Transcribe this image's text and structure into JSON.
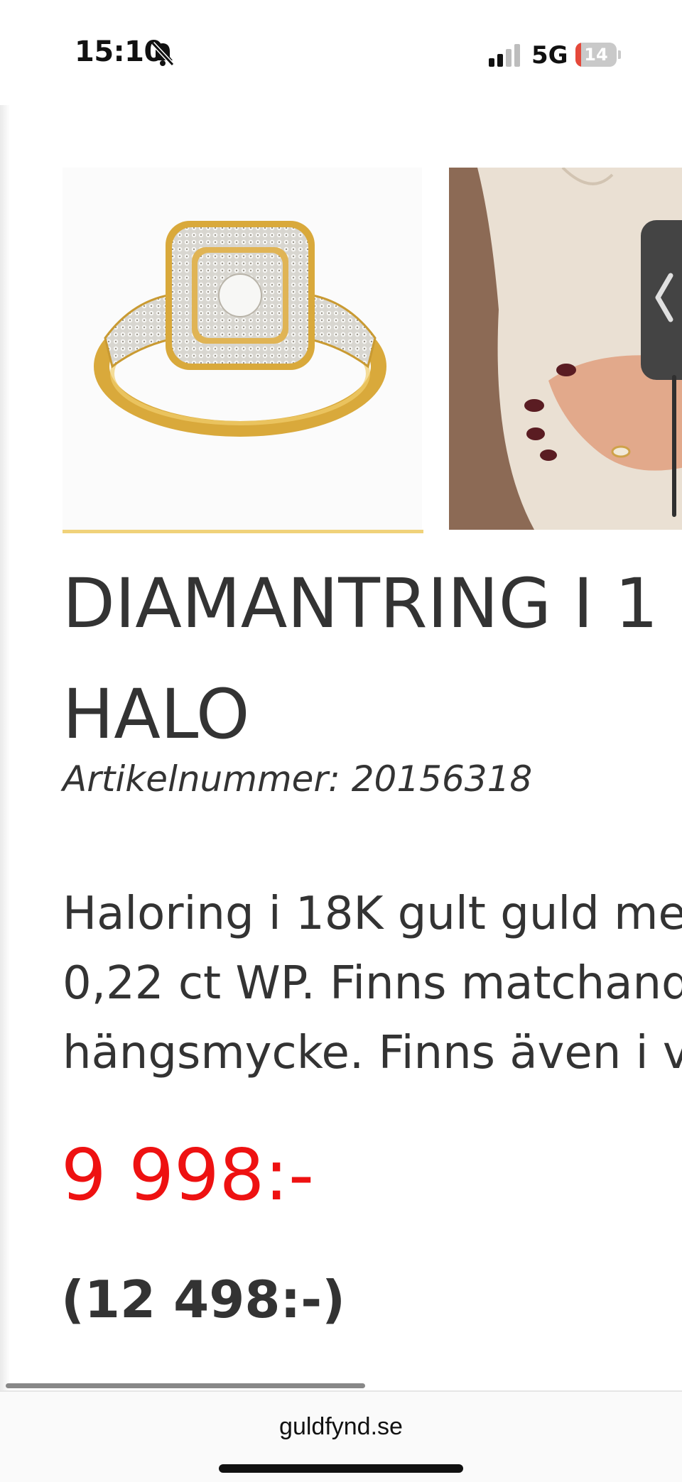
{
  "status_bar": {
    "time": "15:10",
    "network": "5G",
    "battery_level": "14",
    "battery_fraction": 0.14,
    "icons": [
      "bell-slash-icon",
      "signal-icon"
    ]
  },
  "product": {
    "title": "DIAMANTRING I 1",
    "title_line2": "HALO",
    "article_label": "Artikelnummer: 20156318",
    "description": "Haloring i 18K gult guld me 0,22 ct WP. Finns matchand hängsmycke. Finns även i v",
    "price": "9 998:-",
    "old_price": "(12 498:-)"
  },
  "gallery": {
    "prev_arrow_icon": "chevron-left-icon",
    "images": [
      "ring-product-image",
      "ring-on-hand-image"
    ]
  },
  "browser": {
    "url": "guldfynd.se"
  },
  "colors": {
    "price": "#ee1111",
    "accent_underline": "#f0d27a",
    "text": "#333333"
  }
}
